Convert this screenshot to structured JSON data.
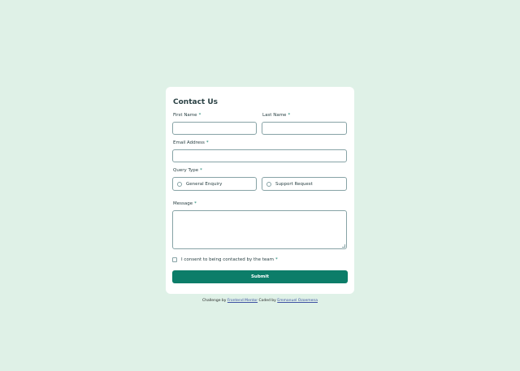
{
  "form": {
    "title": "Contact Us",
    "required_mark": "*",
    "first_name": {
      "label": "First Name",
      "value": ""
    },
    "last_name": {
      "label": "Last Name",
      "value": ""
    },
    "email": {
      "label": "Email Address",
      "value": ""
    },
    "query_type": {
      "label": "Query Type",
      "options": [
        "General Enquiry",
        "Support Request"
      ],
      "selected": ""
    },
    "message": {
      "label": "Message",
      "value": ""
    },
    "consent": {
      "label": "I consent to being contacted by the team",
      "checked": false
    },
    "submit_label": "Submit"
  },
  "attribution": {
    "prefix": "Challenge by",
    "link1": "Frontend Mentor",
    "middle": "Coded by",
    "link2": "Emmanuel Ozoemena"
  },
  "colors": {
    "background": "#dff1e7",
    "card": "#ffffff",
    "accent": "#0c7d69",
    "border": "#87a3a6",
    "text": "#2a4144",
    "link": "#3e52a3"
  }
}
